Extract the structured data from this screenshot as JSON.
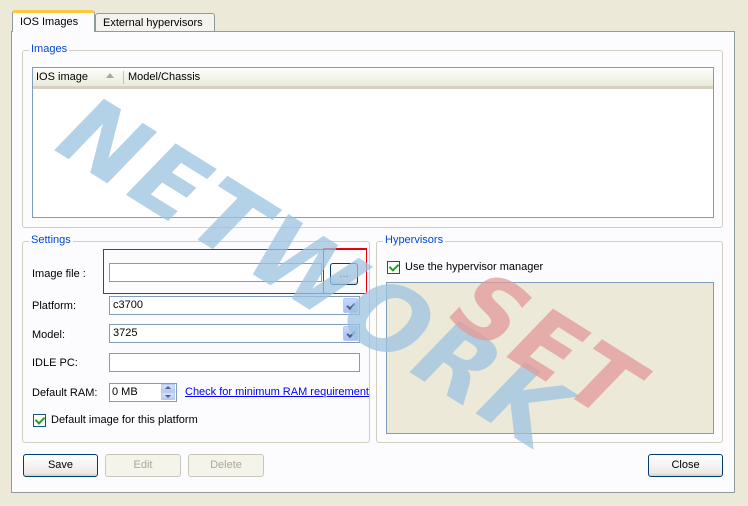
{
  "tabs": [
    {
      "label": "IOS Images",
      "active": true
    },
    {
      "label": "External hypervisors",
      "active": false
    }
  ],
  "images_group": {
    "title": "Images",
    "columns": [
      "IOS image",
      "Model/Chassis"
    ],
    "sort_icon": "sort-ascending-icon",
    "rows": []
  },
  "settings": {
    "title": "Settings",
    "image_file_label": "Image file :",
    "image_file_value": "",
    "browse_label": "...",
    "platform_label": "Platform:",
    "platform_value": "c3700",
    "model_label": "Model:",
    "model_value": "3725",
    "idle_pc_label": "IDLE PC:",
    "idle_pc_value": "",
    "default_ram_label": "Default RAM:",
    "default_ram_value": "0 MB",
    "ram_link": "Check for minimum RAM requirement",
    "default_image_label": "Default image for this platform",
    "default_image_checked": true
  },
  "hypervisors": {
    "title": "Hypervisors",
    "use_manager_label": "Use the hypervisor manager",
    "use_manager_checked": true
  },
  "buttons": {
    "save": "Save",
    "edit": "Edit",
    "delete": "Delete",
    "close": "Close"
  },
  "watermark": {
    "part1": "NETWORK",
    "part2": "SET",
    "color1": "#9cc3e0",
    "color2": "#e39a9a"
  },
  "colors": {
    "group_title": "#0046d5",
    "highlight_box": "#e8000b",
    "link": "#0000ff"
  }
}
